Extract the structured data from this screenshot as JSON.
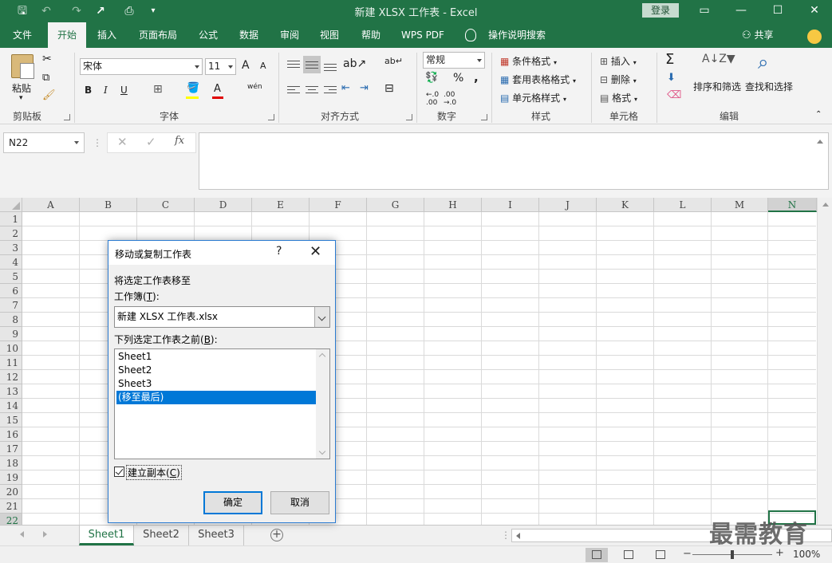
{
  "window": {
    "title": "新建 XLSX 工作表  -  Excel",
    "login_label": "登录"
  },
  "tabs": [
    "文件",
    "开始",
    "插入",
    "页面布局",
    "公式",
    "数据",
    "审阅",
    "视图",
    "帮助",
    "WPS PDF",
    "操作说明搜索"
  ],
  "active_tab": "开始",
  "share_label": "共享",
  "ribbon": {
    "clipboard": {
      "paste": "粘贴",
      "label": "剪贴板"
    },
    "font": {
      "name": "宋体",
      "size": "11",
      "label": "字体",
      "bold": "B",
      "italic": "I",
      "underline": "U",
      "grow": "A",
      "shrink": "A",
      "color_letter": "A",
      "phonetic": "wén"
    },
    "alignment": {
      "label": "对齐方式"
    },
    "number": {
      "format": "常规",
      "label": "数字",
      "percent": "%",
      "comma": ","
    },
    "styles": {
      "conditional": "条件格式",
      "table": "套用表格格式",
      "cell": "单元格样式",
      "label": "样式"
    },
    "cells": {
      "insert": "插入",
      "delete": "删除",
      "format": "格式",
      "label": "单元格"
    },
    "editing": {
      "sort": "排序和筛选",
      "find": "查找和选择",
      "label": "编辑"
    }
  },
  "formula_bar": {
    "name_box": "N22",
    "cancel": "✕",
    "enter": "✓",
    "fx": "fx",
    "value": ""
  },
  "grid": {
    "columns": [
      "A",
      "B",
      "C",
      "D",
      "E",
      "F",
      "G",
      "H",
      "I",
      "J",
      "K",
      "L",
      "M",
      "N"
    ],
    "rows": [
      "1",
      "2",
      "3",
      "4",
      "5",
      "6",
      "7",
      "8",
      "9",
      "10",
      "11",
      "12",
      "13",
      "14",
      "15",
      "16",
      "17",
      "18",
      "19",
      "20",
      "21",
      "22"
    ],
    "selected_cell": "N22"
  },
  "sheets": [
    "Sheet1",
    "Sheet2",
    "Sheet3"
  ],
  "active_sheet": "Sheet1",
  "status": {
    "zoom": "100%"
  },
  "watermark": "最需教育",
  "dialog": {
    "title": "移动或复制工作表",
    "help": "?",
    "close": "✕",
    "move_label": "将选定工作表移至",
    "workbook_label_pre": "工作簿(",
    "workbook_hotkey": "T",
    "workbook_label_post": "):",
    "workbook_value": "新建 XLSX 工作表.xlsx",
    "before_label_pre": "下列选定工作表之前(",
    "before_hotkey": "B",
    "before_label_post": "):",
    "before_items": [
      "Sheet1",
      "Sheet2",
      "Sheet3",
      "(移至最后)"
    ],
    "selected_index": 3,
    "copy_label_pre": "建立副本(",
    "copy_hotkey": "C",
    "copy_label_post": ")",
    "copy_checked": true,
    "ok": "确定",
    "cancel": "取消"
  }
}
